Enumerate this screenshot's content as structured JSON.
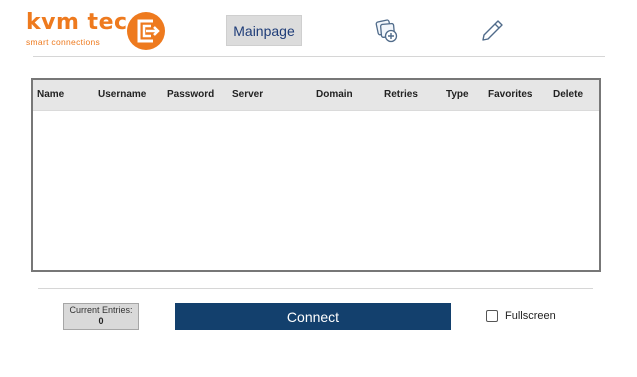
{
  "brand": {
    "name": "kvm tec",
    "tagline": "smart connections",
    "logo_icon": "kvm-tec-logo-icon",
    "color": "#ee7a1e"
  },
  "nav": {
    "mainpage_label": "Mainpage",
    "add_icon": "add-connection-icon",
    "edit_icon": "pencil-edit-icon"
  },
  "table": {
    "headers": [
      "Name",
      "Username",
      "Password",
      "Server",
      "Domain",
      "Retries",
      "Type",
      "Favorites",
      "Delete"
    ],
    "rows": []
  },
  "footer": {
    "entries_label": "Current Entries:",
    "entries_count": "0",
    "connect_label": "Connect",
    "fullscreen_label": "Fullscreen",
    "fullscreen_checked": false
  },
  "colors": {
    "accent": "#ee7a1e",
    "primary": "#13406d",
    "nav_text": "#1e3c78"
  }
}
